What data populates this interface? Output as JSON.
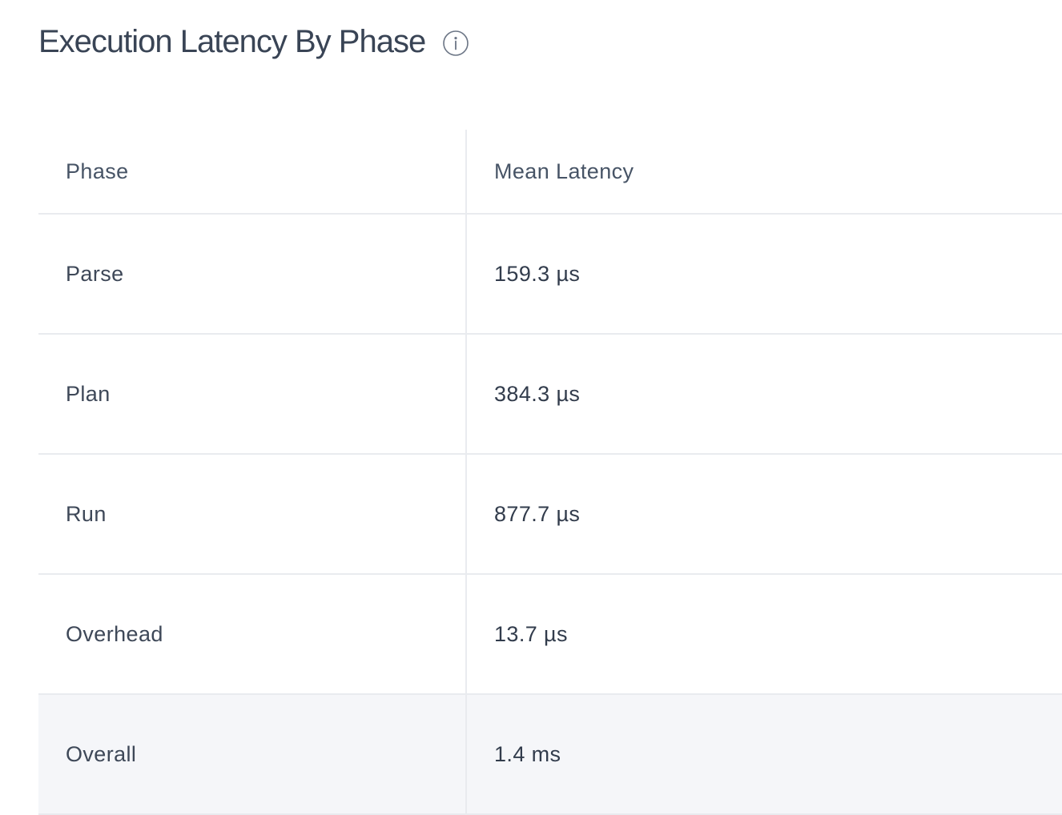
{
  "page": {
    "title": "Execution Latency By Phase",
    "info_icon": "info-icon"
  },
  "table": {
    "columns": [
      "Phase",
      "Mean Latency"
    ],
    "rows": [
      {
        "phase": "Parse",
        "mean_latency": "159.3 µs"
      },
      {
        "phase": "Plan",
        "mean_latency": "384.3 µs"
      },
      {
        "phase": "Run",
        "mean_latency": "877.7 µs"
      },
      {
        "phase": "Overhead",
        "mean_latency": "13.7 µs"
      }
    ],
    "total": {
      "phase": "Overall",
      "mean_latency": "1.4 ms"
    }
  },
  "colors": {
    "text": "#394455",
    "border": "#e9ebef",
    "total_row_bg": "#f5f6f9",
    "icon_stroke": "#6b7585"
  }
}
